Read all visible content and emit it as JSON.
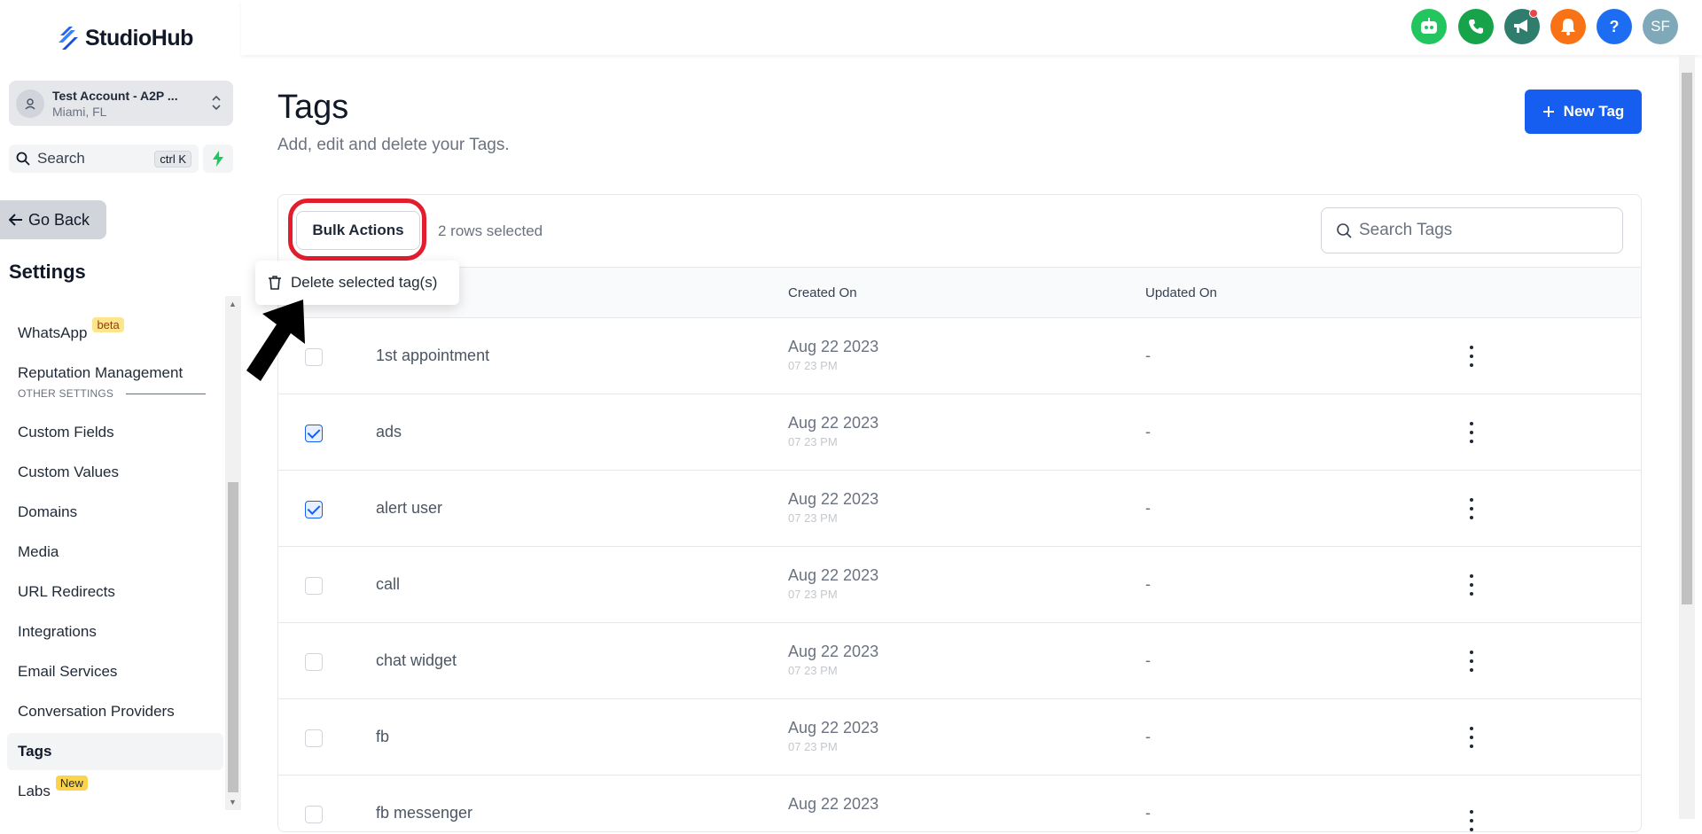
{
  "app": {
    "logo_text": "StudioHub"
  },
  "account": {
    "name": "Test Account - A2P ...",
    "location": "Miami, FL"
  },
  "search": {
    "label": "Search",
    "shortcut": "ctrl K"
  },
  "sidebar": {
    "go_back": "Go Back",
    "settings_title": "Settings",
    "items_top": [
      {
        "label": "WhatsApp",
        "badge": "beta"
      },
      {
        "label": "Reputation Management"
      }
    ],
    "section_label": "OTHER SETTINGS",
    "items": [
      {
        "label": "Custom Fields"
      },
      {
        "label": "Custom Values"
      },
      {
        "label": "Domains"
      },
      {
        "label": "Media"
      },
      {
        "label": "URL Redirects"
      },
      {
        "label": "Integrations"
      },
      {
        "label": "Email Services"
      },
      {
        "label": "Conversation Providers"
      },
      {
        "label": "Tags",
        "active": true
      },
      {
        "label": "Labs",
        "badge": "New"
      }
    ]
  },
  "header": {
    "icons": [
      {
        "name": "bot-icon",
        "color": "#22c55e"
      },
      {
        "name": "phone-icon",
        "color": "#16a34a"
      },
      {
        "name": "megaphone-icon",
        "color": "#2f7d6d"
      },
      {
        "name": "bell-icon",
        "color": "#f97316"
      },
      {
        "name": "help-icon",
        "color": "#1d6df2",
        "text": "?"
      },
      {
        "name": "user-avatar",
        "color": "#7fa8b8",
        "text": "SF"
      }
    ]
  },
  "page": {
    "title": "Tags",
    "subtitle": "Add, edit and delete your Tags.",
    "new_tag_label": "New Tag"
  },
  "toolbar": {
    "bulk_actions_label": "Bulk Actions",
    "rows_selected": "2 rows selected",
    "search_placeholder": "Search Tags"
  },
  "dropdown": {
    "delete_label": "Delete selected tag(s)"
  },
  "table": {
    "columns": [
      "Created On",
      "Updated On"
    ],
    "rows": [
      {
        "name": "1st appointment",
        "created": "Aug 22 2023",
        "time": "07 23 PM",
        "updated": "-",
        "checked": false
      },
      {
        "name": "ads",
        "created": "Aug 22 2023",
        "time": "07 23 PM",
        "updated": "-",
        "checked": true
      },
      {
        "name": "alert user",
        "created": "Aug 22 2023",
        "time": "07 23 PM",
        "updated": "-",
        "checked": true
      },
      {
        "name": "call",
        "created": "Aug 22 2023",
        "time": "07 23 PM",
        "updated": "-",
        "checked": false
      },
      {
        "name": "chat widget",
        "created": "Aug 22 2023",
        "time": "07 23 PM",
        "updated": "-",
        "checked": false
      },
      {
        "name": "fb",
        "created": "Aug 22 2023",
        "time": "07 23 PM",
        "updated": "-",
        "checked": false
      },
      {
        "name": "fb messenger",
        "created": "Aug 22 2023",
        "time": "",
        "updated": "-",
        "checked": false
      }
    ]
  },
  "colors": {
    "accent": "#155eef",
    "highlight": "#e11d2e"
  }
}
